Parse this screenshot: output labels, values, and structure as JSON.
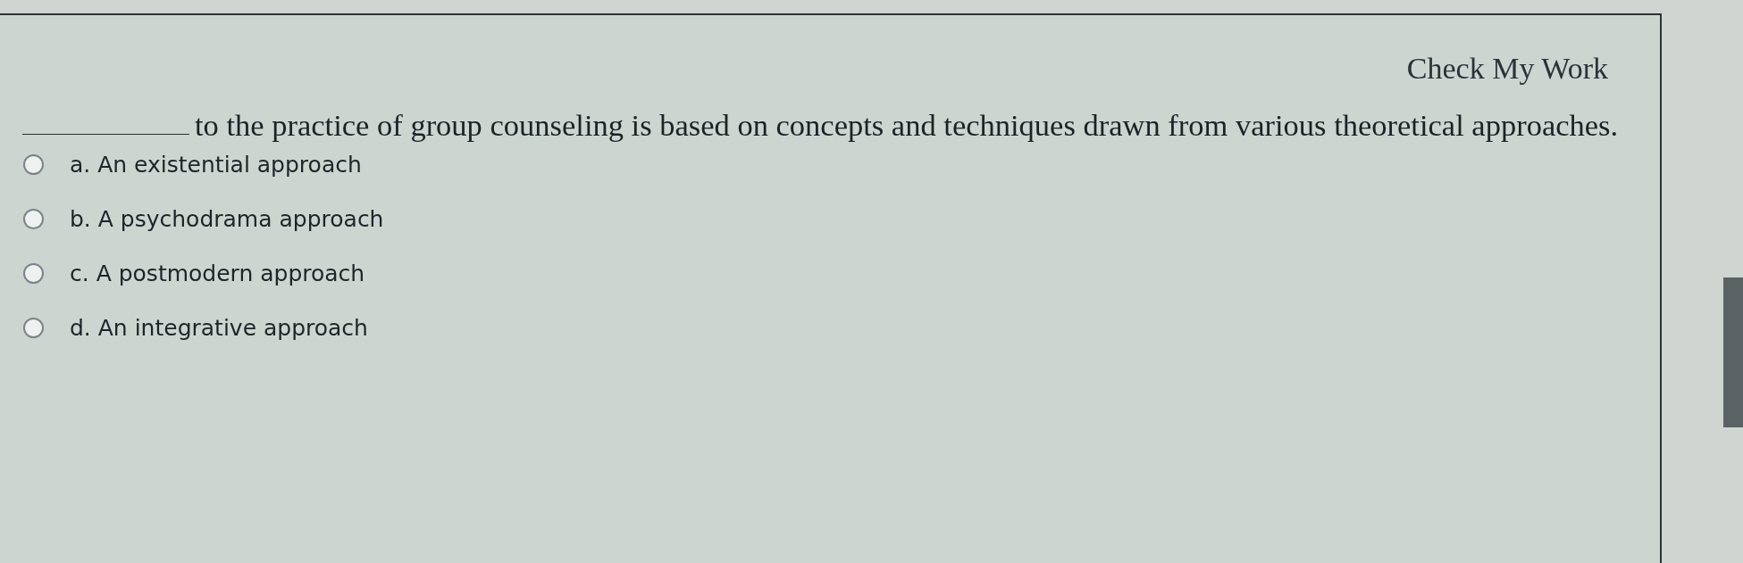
{
  "header": {
    "link": "Check My Work"
  },
  "question": {
    "text": "to the practice of group counseling is based on concepts and techniques drawn from various theoretical approaches."
  },
  "options": [
    {
      "label": "a. An existential approach",
      "selected": false
    },
    {
      "label": "b. A psychodrama approach",
      "selected": false
    },
    {
      "label": "c. A postmodern approach",
      "selected": false
    },
    {
      "label": "d. An integrative approach",
      "selected": false
    }
  ]
}
